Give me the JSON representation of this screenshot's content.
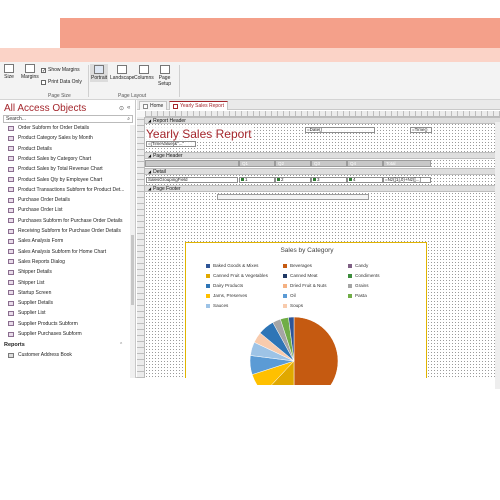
{
  "ribbon": {
    "size_label": "Size",
    "margins_label": "Margins",
    "show_margins_label": "Show Margins",
    "print_data_only_label": "Print Data Only",
    "portrait_label": "Portrait",
    "landscape_label": "Landscape",
    "columns_label": "Columns",
    "page_setup_label_1": "Page",
    "page_setup_label_2": "Setup",
    "group_page_size": "Page Size",
    "group_page_layout": "Page Layout",
    "show_margins_checked": true,
    "print_data_only_checked": false
  },
  "nav": {
    "title": "All Access Objects",
    "search_placeholder": "Search...",
    "items": [
      {
        "label": "Order Subform for Order Details"
      },
      {
        "label": "Product Category Sales by Month"
      },
      {
        "label": "Product Details"
      },
      {
        "label": "Product Sales by Category Chart"
      },
      {
        "label": "Product Sales by Total Revenue Chart"
      },
      {
        "label": "Product Sales Qty by Employee Chart"
      },
      {
        "label": "Product Transactions Subform for Product Det..."
      },
      {
        "label": "Purchase Order Details"
      },
      {
        "label": "Purchase Order List"
      },
      {
        "label": "Purchases Subform for Purchase Order Details"
      },
      {
        "label": "Receiving Subform for Purchase Order Details"
      },
      {
        "label": "Sales Analysis Form"
      },
      {
        "label": "Sales Analysis Subform for Home Chart"
      },
      {
        "label": "Sales Reports Dialog"
      },
      {
        "label": "Shipper Details"
      },
      {
        "label": "Shipper List"
      },
      {
        "label": "Startup Screen"
      },
      {
        "label": "Supplier Details"
      },
      {
        "label": "Supplier List"
      },
      {
        "label": "Supplier Products Subform"
      },
      {
        "label": "Supplier Purchases Subform"
      }
    ],
    "section_reports": "Reports",
    "report_items": [
      {
        "label": "Customer Address Book"
      }
    ]
  },
  "tabs": [
    {
      "label": "Home"
    },
    {
      "label": "Yearly Sales Report"
    }
  ],
  "design": {
    "report_header": "Report Header",
    "page_header": "Page Header",
    "detail": "Detail",
    "page_footer": "Page Footer",
    "report_title": "Yearly Sales Report",
    "date_field": "=Date()",
    "time_field": "=Time()",
    "period_field": "=[TimeValue]&\"...\"",
    "group_field": "SalesGroupingField",
    "header_cols": [
      "Q1",
      "Q2",
      "Q3",
      "Q4",
      "Total"
    ],
    "detail_cells": [
      "1",
      "2",
      "3",
      "4"
    ],
    "nz_field": "=Nz([1],0)+Nz([...]"
  },
  "chart": {
    "title": "Sales by Category",
    "legend": [
      {
        "label": "Baked Goods & Mixes",
        "color": "#2f5597"
      },
      {
        "label": "Beverages",
        "color": "#c55a11"
      },
      {
        "label": "Candy",
        "color": "#7f6084"
      },
      {
        "label": "Canned Fruit & Vegetables",
        "color": "#e0a800"
      },
      {
        "label": "Canned Meat",
        "color": "#1f3864"
      },
      {
        "label": "Condiments",
        "color": "#3c8c3c"
      },
      {
        "label": "Dairy Products",
        "color": "#2e75b6"
      },
      {
        "label": "Dried Fruit & Nuts",
        "color": "#f4b183"
      },
      {
        "label": "Grains",
        "color": "#a5a5a5"
      },
      {
        "label": "Jams, Preserves",
        "color": "#ffc000"
      },
      {
        "label": "Oil",
        "color": "#5b9bd5"
      },
      {
        "label": "Pasta",
        "color": "#70ad47"
      },
      {
        "label": "Sauces",
        "color": "#9dc3e6"
      },
      {
        "label": "Soups",
        "color": "#f8cbad"
      }
    ]
  }
}
